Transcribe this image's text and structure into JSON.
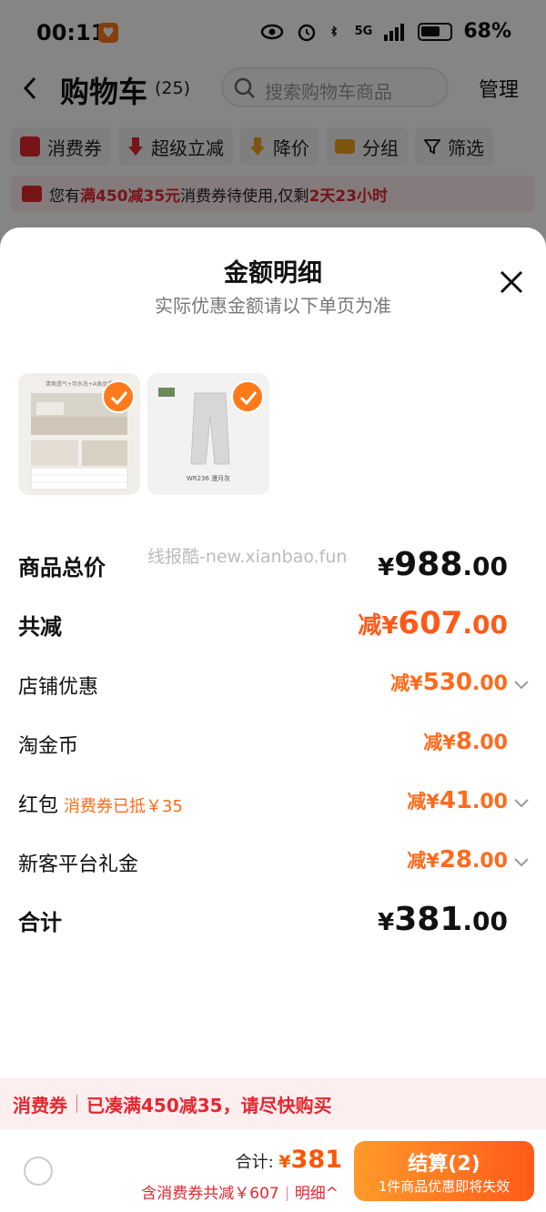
{
  "status_bar": {
    "time": "00:11",
    "network": "5G",
    "battery": "68%"
  },
  "nav": {
    "title": "购物车",
    "count": "(25)",
    "search_placeholder": "搜索购物车商品",
    "manage": "管理"
  },
  "filters": [
    {
      "label": "消费券",
      "icon": "coupon-icon",
      "color": "#e4272f"
    },
    {
      "label": "超级立减",
      "icon": "down-arrow-icon",
      "color": "#e4272f"
    },
    {
      "label": "降价",
      "icon": "price-drop-icon",
      "color": "#f2a21a"
    },
    {
      "label": "分组",
      "icon": "folder-icon",
      "color": "#f2a21a"
    },
    {
      "label": "筛选",
      "icon": "filter-icon",
      "color": "#222222"
    }
  ],
  "notice": {
    "prefix": "您有",
    "highlight1": "满450减35元",
    "middle": "消费券待使用,仅剩",
    "highlight2": "2天23小时"
  },
  "sheet": {
    "title": "金额明细",
    "subtitle": "实际优惠金额请以下单页为准",
    "products": [
      {
        "name": "bed-mattress-product",
        "thumb_text": "清爽透气+可水洗+A类品质"
      },
      {
        "name": "pants-product",
        "thumb_text": "WR236 漫月灰"
      }
    ],
    "watermark": "线报酷-new.xianbao.fun",
    "rows": [
      {
        "label": "商品总价",
        "prefix": "",
        "yen": "¥",
        "int": "988",
        "dec": ".00",
        "tag": ""
      },
      {
        "label": "共减",
        "prefix": "减",
        "yen": "¥",
        "int": "607",
        "dec": ".00",
        "tag": ""
      },
      {
        "label": "店铺优惠",
        "prefix": "减",
        "yen": "¥",
        "int": "530",
        "dec": ".00",
        "tag": ""
      },
      {
        "label": "淘金币",
        "prefix": "减",
        "yen": "¥",
        "int": "8",
        "dec": ".00",
        "tag": ""
      },
      {
        "label": "红包",
        "prefix": "减",
        "yen": "¥",
        "int": "41",
        "dec": ".00",
        "tag": "消费券已抵￥35"
      },
      {
        "label": "新客平台礼金",
        "prefix": "减",
        "yen": "¥",
        "int": "28",
        "dec": ".00",
        "tag": ""
      },
      {
        "label": "合计",
        "prefix": "",
        "yen": "¥",
        "int": "381",
        "dec": ".00",
        "tag": ""
      }
    ]
  },
  "coupon_strip": {
    "left": "消费券",
    "right": "已凑满450减35，请尽快购买"
  },
  "bottom": {
    "total_label": "合计:",
    "yen": "¥",
    "total": "381",
    "discount": "含消费券共减￥607",
    "detail": "明细^",
    "checkout": "结算(2)",
    "checkout_sub": "1件商品优惠即将失效"
  },
  "colors": {
    "accent": "#ff5500",
    "red": "#e4272f",
    "orange": "#ff6a1a"
  }
}
